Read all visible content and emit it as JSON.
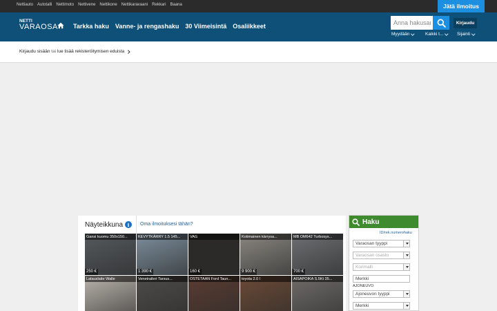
{
  "topbar": {
    "links": [
      "Nettiauto",
      "Autotalli",
      "Nettimoto",
      "Nettivene",
      "Nettikone",
      "Nettikaravaani",
      "Rekkari",
      "Baana"
    ],
    "post_ad_label": "Jätä ilmoitus"
  },
  "header": {
    "logo_top": "NETTI",
    "logo_bottom": "VARAOSA",
    "nav": [
      "Tarkka haku",
      "Vanne- ja rengashaku",
      "30 Viimeisintä",
      "Osaliikkeet"
    ],
    "search_placeholder": "Anna hakusana",
    "login_label": "Kirjaudu",
    "subnav": [
      "Myydään",
      "Kaikki t...",
      "Sijainti"
    ]
  },
  "login_strip": {
    "login_link": "Kirjaudu sisään",
    "or": "tai",
    "more_link": "lue lisää rekisteröitymisen eduista"
  },
  "showcase": {
    "title": "Näyteikkuna",
    "own_ad_link": "Oma ilmoituksesi tähän?",
    "items": [
      {
        "caption": "Gansi kuomu 350x150...",
        "price": "250 €",
        "bg": "#555a5e"
      },
      {
        "caption": "KEVYTKÄRRY 1.5 145...",
        "price": "1 390 €",
        "bg": "#7c8e9c"
      },
      {
        "caption": "VAG",
        "price": "160 €",
        "bg": "#2c2a28"
      },
      {
        "caption": "Kotimainen kärrysa...",
        "price": "9 900 €",
        "bg": "#8a8780"
      },
      {
        "caption": "MB OM642 Turbosys...",
        "price": "700 €",
        "bg": "#6d6f72"
      },
      {
        "caption": "Latauslaite Walle",
        "price": "",
        "bg": "#b9b3ab"
      },
      {
        "caption": "Venetraileri Tarsus...",
        "price": "",
        "bg": "#4d4c49"
      },
      {
        "caption": "OSTETAAN Ford Taun...",
        "price": "",
        "bg": "#5a3c31"
      },
      {
        "caption": "toyota 2.0 l",
        "price": "",
        "bg": "#6b4a36"
      },
      {
        "caption": "AISAPOIKA S.5Kt 35...",
        "price": "",
        "bg": "#6f6c69"
      }
    ]
  },
  "search_panel": {
    "title": "Haku",
    "id_link": "ID/rek.numerohaku",
    "fields": [
      {
        "label": "Varaosan tyyppi",
        "dim": false
      },
      {
        "label": "Varaosan osasto",
        "dim": true
      },
      {
        "label": "Korimalli",
        "dim": true
      },
      {
        "label": "Merkki",
        "dim": false
      }
    ],
    "vehicle_label": "AJONEUVO",
    "vehicle_fields": [
      "Ajoneuvon tyyppi",
      "Merkki"
    ]
  },
  "colors": {
    "header_bg": "#0e5078",
    "accent_blue": "#1d8fe0",
    "search_green": "#3e8a2f"
  }
}
